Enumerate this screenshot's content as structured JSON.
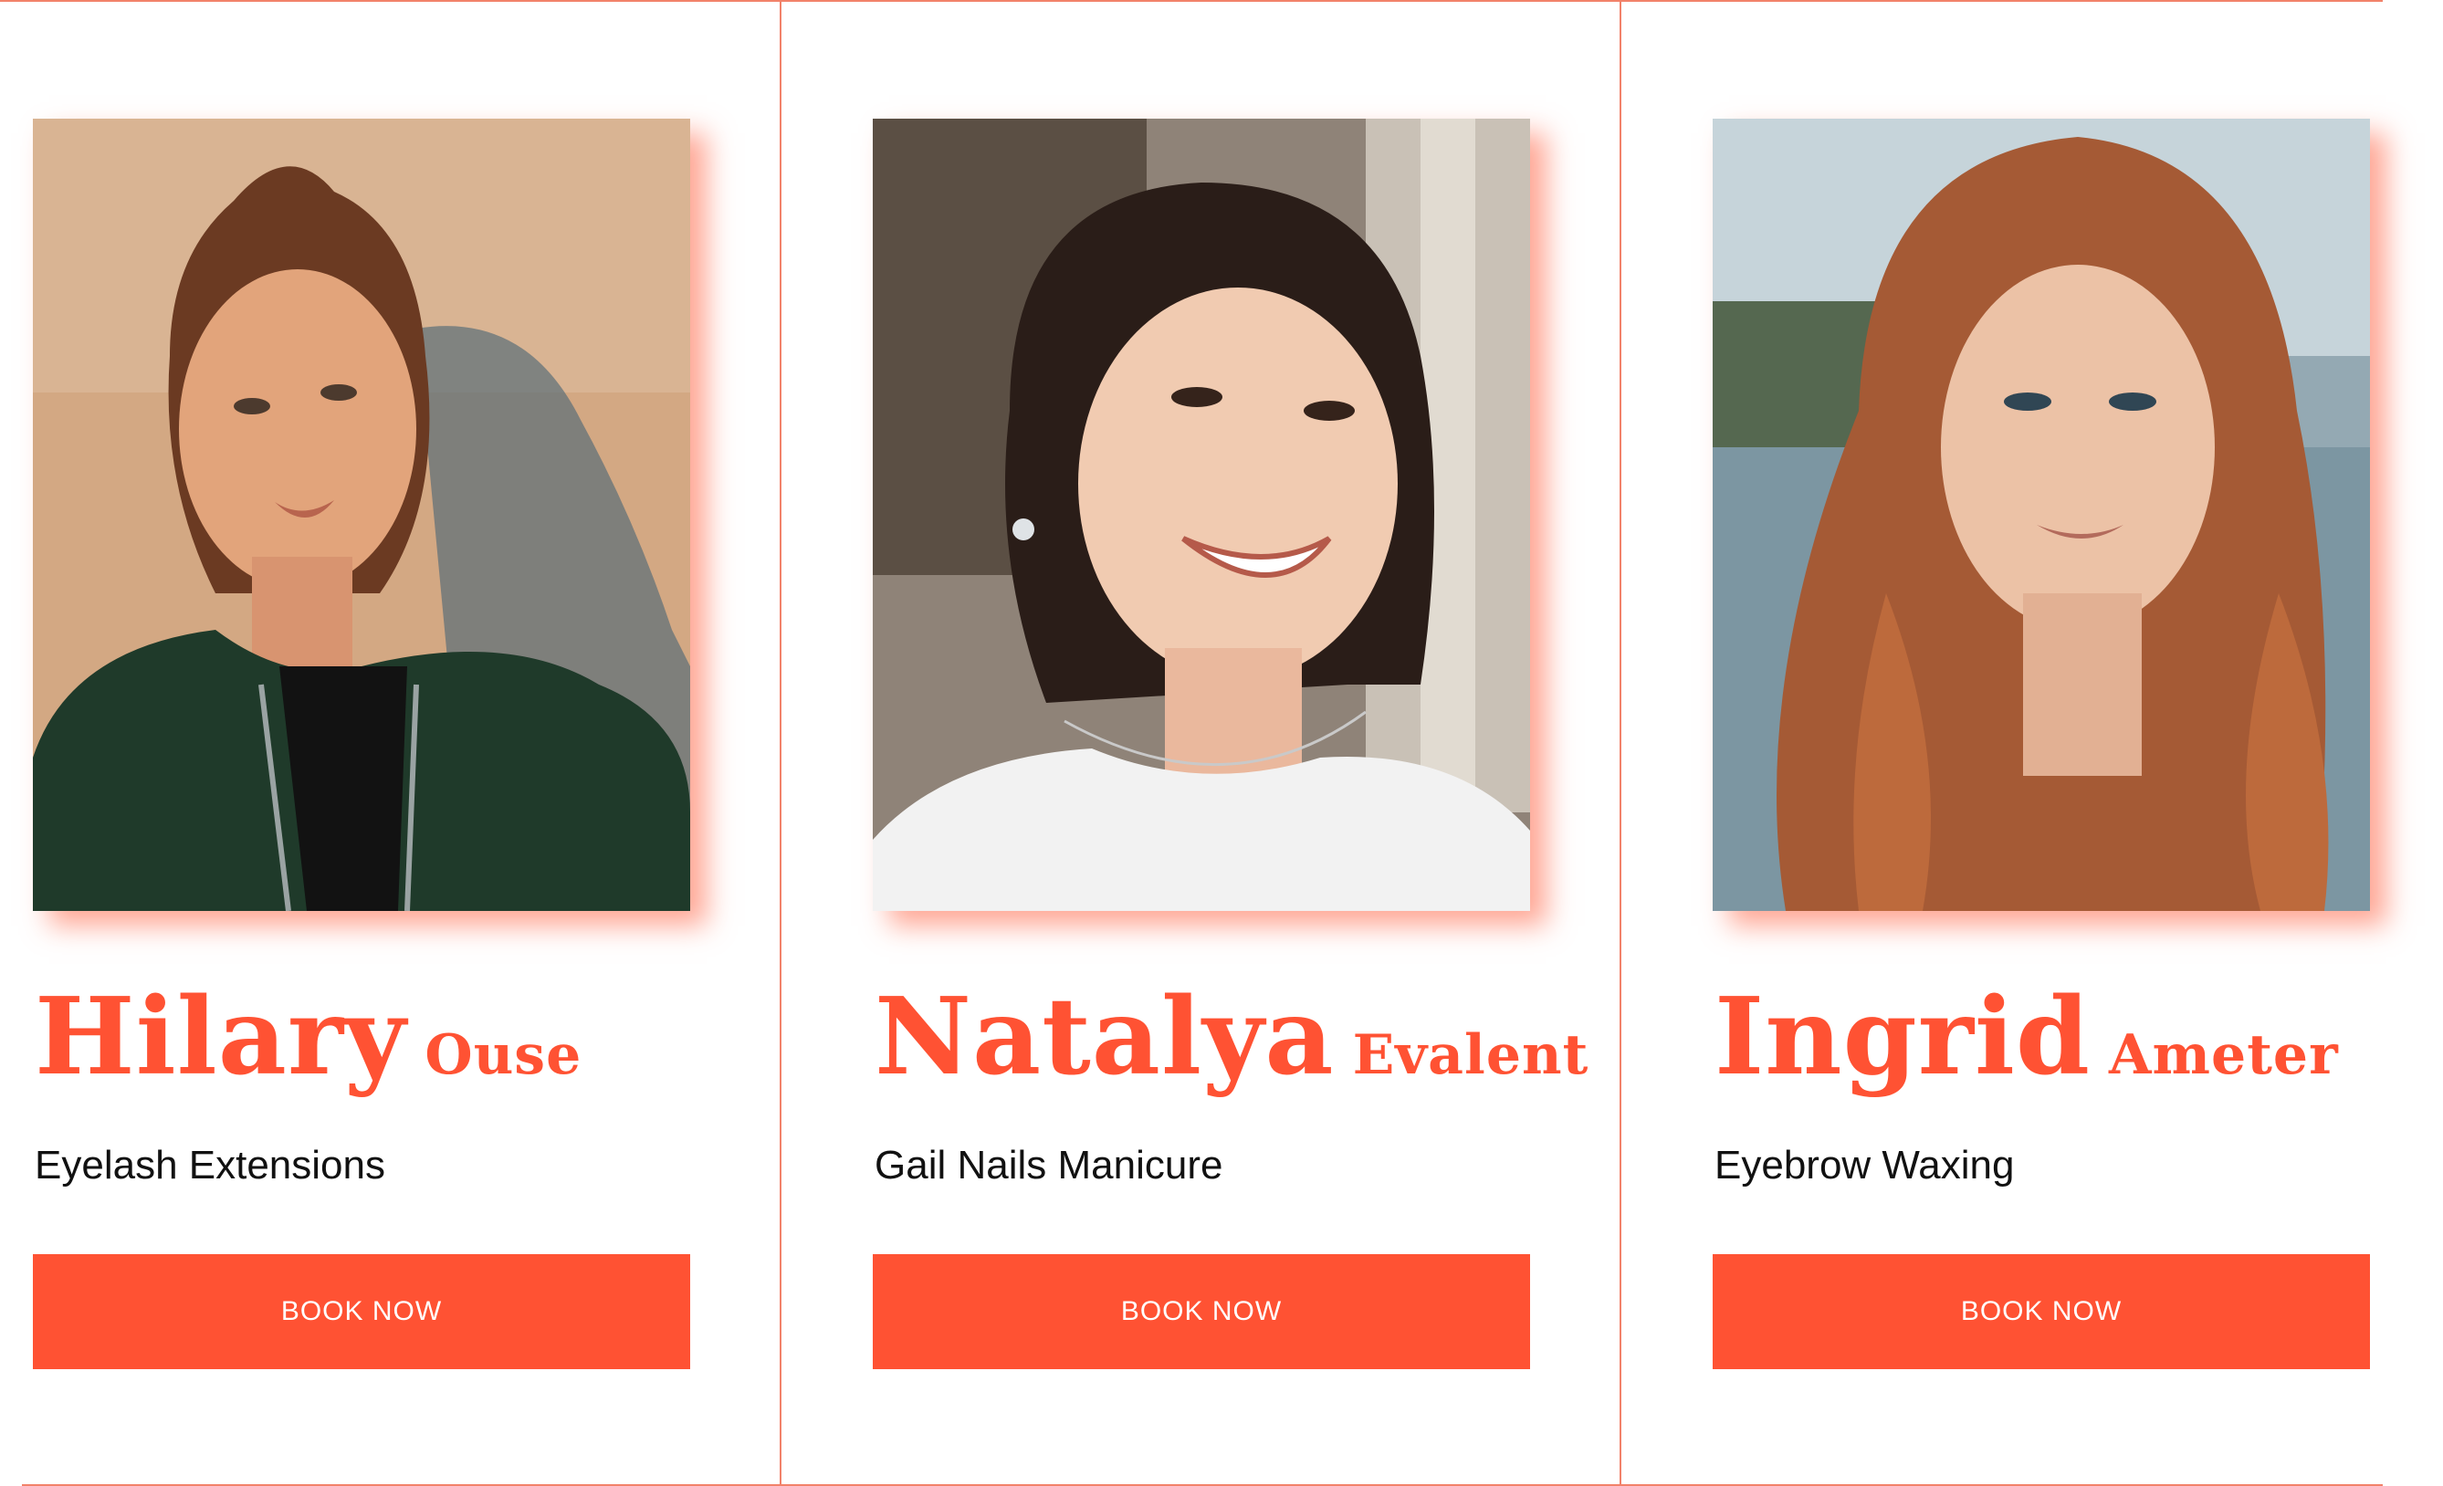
{
  "colors": {
    "accent": "#ff5233",
    "divider": "#f2826a",
    "text": "#111111"
  },
  "cards": [
    {
      "first_name": "Hilary",
      "last_name": "Ouse",
      "service": "Eyelash Extensions",
      "button_label": "BOOK NOW",
      "photo_description": "woman with hair bun in green jacket"
    },
    {
      "first_name": "Natalya",
      "last_name": "Evalent",
      "service": "Gail Nails Manicure",
      "button_label": "BOOK NOW",
      "photo_description": "smiling woman with dark hair in white top"
    },
    {
      "first_name": "Ingrid",
      "last_name": "Ameter",
      "service": "Eyebrow Waxing",
      "button_label": "BOOK NOW",
      "photo_description": "woman with long wavy auburn hair"
    }
  ]
}
